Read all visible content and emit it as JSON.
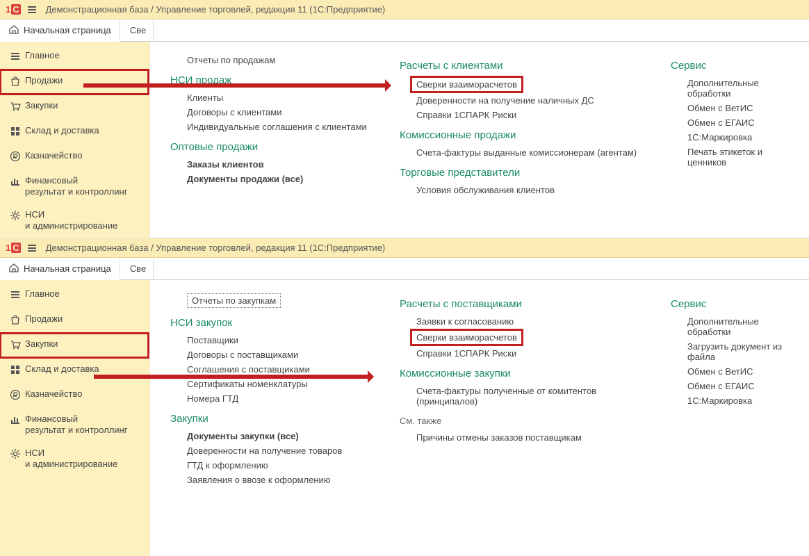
{
  "title": "Демонстрационная база / Управление торговлей, редакция 11   (1С:Предприятие)",
  "home_tab": "Начальная страница",
  "cut_tab_top": "Све",
  "cut_tab_bot": "Све",
  "sidebar": [
    {
      "icon": "menu",
      "label": "Главное"
    },
    {
      "icon": "bag",
      "label": "Продажи"
    },
    {
      "icon": "cart",
      "label": "Закупки"
    },
    {
      "icon": "grid",
      "label": "Склад и доставка"
    },
    {
      "icon": "ruble",
      "label": "Казначейство"
    },
    {
      "icon": "bars",
      "label": "Финансовый\nрезультат и контроллинг"
    },
    {
      "icon": "gear",
      "label": "НСИ\nи администрирование"
    }
  ],
  "top": {
    "col1_toplink": "Отчеты по продажам",
    "sections1": [
      {
        "h": "НСИ продаж",
        "items": [
          "Клиенты",
          "Договоры с клиентами",
          "Индивидуальные соглашения с клиентами"
        ]
      },
      {
        "h": "Оптовые продажи",
        "items": [
          {
            "t": "Заказы клиентов",
            "b": true
          },
          {
            "t": "Документы продажи (все)",
            "b": true
          }
        ]
      }
    ],
    "sections2": [
      {
        "h": "Расчеты с клиентами",
        "items": [
          {
            "t": "Сверки взаиморасчетов",
            "boxed": true
          },
          "Доверенности на получение наличных ДС",
          "Справки 1СПАРК Риски"
        ]
      },
      {
        "h": "Комиссионные продажи",
        "items": [
          "Счета-фактуры выданные комиссионерам (агентам)"
        ]
      },
      {
        "h": "Торговые представители",
        "items": [
          "Условия обслуживания клиентов"
        ]
      }
    ],
    "sections3": [
      {
        "h": "Сервис",
        "items": [
          "Дополнительные обработки",
          "Обмен с ВетИС",
          "Обмен с ЕГАИС",
          "1С:Маркировка",
          "Печать этикеток и ценников"
        ]
      }
    ]
  },
  "bot": {
    "col1_toplink": "Отчеты по закупкам",
    "sections1": [
      {
        "h": "НСИ закупок",
        "items": [
          "Поставщики",
          "Договоры с поставщиками",
          "Соглашения с поставщиками",
          "Сертификаты номенклатуры",
          "Номера ГТД"
        ]
      },
      {
        "h": "Закупки",
        "items": [
          {
            "t": "Документы закупки (все)",
            "b": true
          },
          "Доверенности на получение товаров",
          "ГТД к оформлению",
          "Заявления о ввозе к оформлению"
        ]
      }
    ],
    "sections2": [
      {
        "h": "Расчеты с поставщиками",
        "items": [
          "Заявки к согласованию",
          {
            "t": "Сверки взаиморасчетов",
            "boxed": true
          },
          "Справки 1СПАРК Риски"
        ]
      },
      {
        "h": "Комиссионные закупки",
        "items": [
          "Счета-фактуры полученные от комитентов (принципалов)"
        ]
      },
      {
        "h": "См. также",
        "plain": true,
        "items": [
          "Причины отмены заказов поставщикам"
        ]
      }
    ],
    "sections3": [
      {
        "h": "Сервис",
        "items": [
          "Дополнительные обработки",
          "Загрузить документ из файла",
          "Обмен с ВетИС",
          "Обмен с ЕГАИС",
          "1С:Маркировка"
        ]
      }
    ]
  }
}
